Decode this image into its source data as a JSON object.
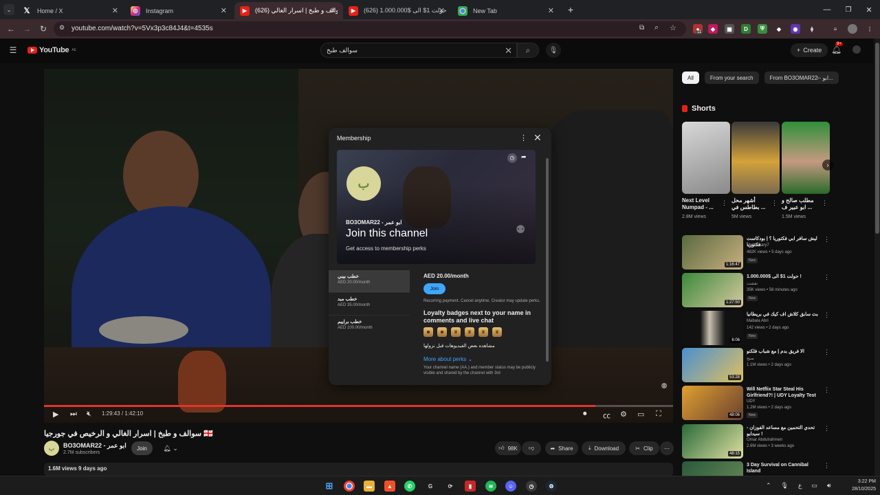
{
  "browser": {
    "tabs": [
      {
        "label": "Home / X",
        "icon": "x-logo-icon"
      },
      {
        "label": "Instagram",
        "icon": "instagram-icon"
      },
      {
        "label": "سوالف و طبخ | اسرار الغالي (626)",
        "icon": "youtube-icon",
        "active": true
      },
      {
        "label": "(626) حولت 1$ الى $1.000.000",
        "icon": "youtube-icon"
      },
      {
        "label": "New Tab",
        "icon": "chrome-icon"
      }
    ],
    "url": "youtube.com/watch?v=5Vx3p3c84J4&t=4535s",
    "ext_badge": "11"
  },
  "youtube": {
    "logo": "YouTube",
    "region": "AE",
    "search_query": "سوالف طبخ",
    "create_label": "Create",
    "notif_count": "9+"
  },
  "player": {
    "time_current": "1:29:43",
    "time_total": "1:42:10",
    "progress": 0.876,
    "accent": "#e0342d"
  },
  "membership": {
    "title": "Membership",
    "banner_channel": "BO3OMAR22 - ابو عمر",
    "banner_heading": "Join this channel",
    "banner_sub": "Get access to membership perks",
    "tiers": [
      {
        "name": "خطب بيبي",
        "price": "AED 20.00/month"
      },
      {
        "name": "خطب مبد",
        "price": "AED 35.00/month"
      },
      {
        "name": "خطب براييم",
        "price": "AED 100.00/month"
      }
    ],
    "selected_price": "AED 20.00/month",
    "join_label": "Join",
    "recurring_note": "Recurring payment. Cancel anytime. Creator may update perks.",
    "badges_title": "Loyalty badges next to your name in comments and live chat",
    "perk_text": "مشاهده بعض الفيديوهات قبل نزولها",
    "more_perks": "More about perks",
    "footer_note": "Your channel name (AA.) and member status may be publicly visible and shared by the channel with 3rd"
  },
  "video": {
    "title": "سوالف و طبخ | اسرار الغالي و الرخيص في جورجيا 🇬🇪",
    "channel": "BO3OMAR22 - ابو عمر",
    "subscribers": "2.7M subscribers",
    "join_label": "Join",
    "likes": "98K",
    "share_label": "Share",
    "download_label": "Download",
    "clip_label": "Clip",
    "views_line": "1.6M views  9 days ago"
  },
  "sidebar": {
    "chips": [
      "All",
      "From your search",
      "From BO3OMAR22 - ابو..."
    ],
    "shorts_title": "Shorts",
    "shorts": [
      {
        "title": "Next Level Numpad - ...",
        "views": "2.8M views"
      },
      {
        "title": "أشهر محل بطاطس في ...",
        "views": "5M views"
      },
      {
        "title": "مطلب صالح و ابو عبير ف ...",
        "views": "1.5M views"
      }
    ],
    "recs": [
      {
        "title": "ليش سافر ابي فكتوريا ؟ | بودكاست فكتوريا",
        "channel": "Mebossary7",
        "views": "482K views • 5 days ago",
        "new": "New",
        "dur": "1:16:47"
      },
      {
        "title": "حولت 1$ الى $1.000.000 !",
        "channel": "نقشت",
        "views": "35K views • 56 minutes ago",
        "new": "New",
        "dur": "1:27:50"
      },
      {
        "title": "بث سابق كلاش اف كيك في بريطانيا",
        "channel": "Mabala Abri",
        "views": "142 views • 2 days ago",
        "new": "New",
        "dur": "6:06"
      },
      {
        "title": "الا فريق بدم | مع شباب فلكنو",
        "channel": "منيح",
        "views": "1.1M views • 2 days ago",
        "new": "",
        "dur": "53:28"
      },
      {
        "title": "Will Netflix Star Steal His Girlfriend?! | UDY Loyalty Test",
        "channel": "UDY",
        "views": "1.2M views • 2 days ago",
        "new": "New",
        "dur": "48:06"
      },
      {
        "title": "تحدي التحمين مع مساعد الفوزان - سيدايو !",
        "channel": "Omar Abdulrahmen",
        "views": "2.6M views • 3 weeks ago",
        "new": "",
        "dur": "48:15"
      },
      {
        "title": "3 Day Survival on Cannibal Island",
        "channel": "",
        "views": "",
        "new": "",
        "dur": ""
      }
    ]
  },
  "taskbar": {
    "time": "3:22 PM",
    "date": "28/10/2025",
    "lang": "ع"
  }
}
